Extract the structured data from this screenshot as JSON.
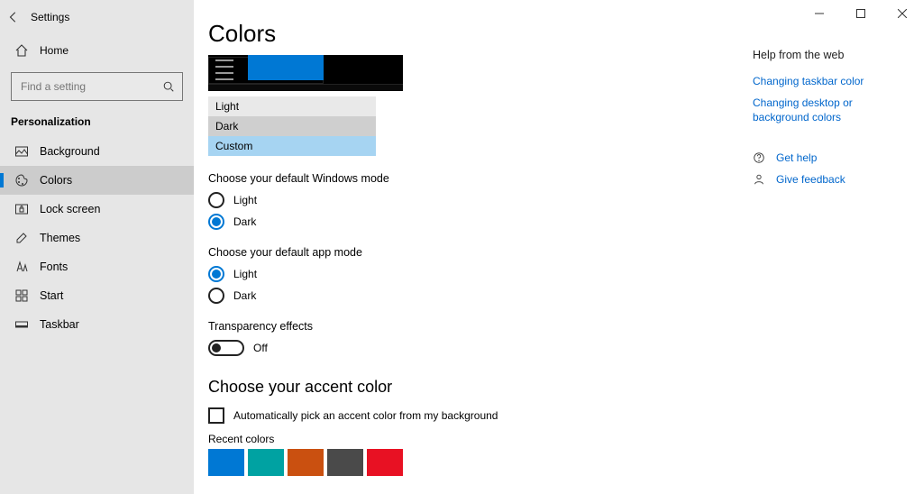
{
  "app_title": "Settings",
  "home_label": "Home",
  "search_placeholder": "Find a setting",
  "nav_header": "Personalization",
  "nav": [
    {
      "id": "background",
      "label": "Background"
    },
    {
      "id": "colors",
      "label": "Colors"
    },
    {
      "id": "lockscreen",
      "label": "Lock screen"
    },
    {
      "id": "themes",
      "label": "Themes"
    },
    {
      "id": "fonts",
      "label": "Fonts"
    },
    {
      "id": "start",
      "label": "Start"
    },
    {
      "id": "taskbar",
      "label": "Taskbar"
    }
  ],
  "nav_active": "colors",
  "page_title": "Colors",
  "color_mode_options": {
    "light": "Light",
    "dark": "Dark",
    "custom": "Custom"
  },
  "sections": {
    "win_mode": {
      "title": "Choose your default Windows mode",
      "opts": [
        "Light",
        "Dark"
      ],
      "selected": "Dark"
    },
    "app_mode": {
      "title": "Choose your default app mode",
      "opts": [
        "Light",
        "Dark"
      ],
      "selected": "Light"
    },
    "transparency": {
      "title": "Transparency effects",
      "state_label": "Off"
    },
    "accent": {
      "title": "Choose your accent color",
      "auto_label": "Automatically pick an accent color from my background"
    },
    "recent": {
      "title": "Recent colors",
      "colors": [
        "#0078d4",
        "#00a2a2",
        "#ca5010",
        "#4a4a4a",
        "#e81123"
      ]
    }
  },
  "right": {
    "help_header": "Help from the web",
    "links": [
      "Changing taskbar color",
      "Changing desktop or background colors"
    ],
    "get_help": "Get help",
    "give_feedback": "Give feedback"
  },
  "icons": {
    "back": "back-icon",
    "home": "home-icon",
    "search": "search-icon",
    "bg": "picture-icon",
    "colors": "palette-icon",
    "lock": "lock-icon",
    "themes": "pencil-icon",
    "fonts": "typography-icon",
    "start": "grid-icon",
    "taskbar": "taskbar-icon",
    "help": "help-icon",
    "feedback": "feedback-icon",
    "min": "minimize-icon",
    "max": "maximize-icon",
    "close": "close-icon"
  }
}
